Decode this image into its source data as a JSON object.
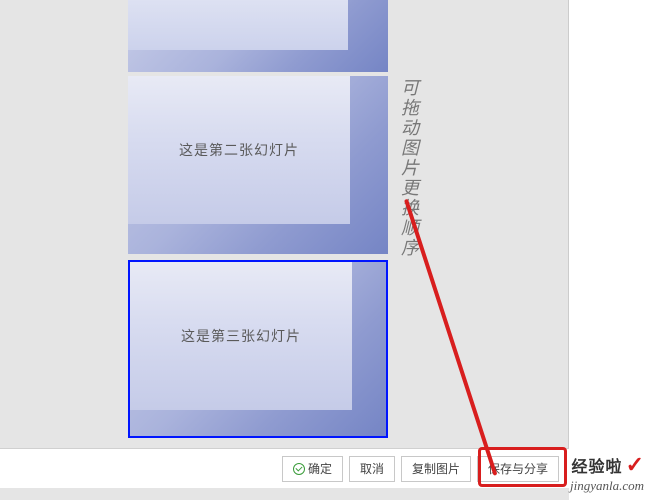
{
  "slides": [
    {
      "text": ""
    },
    {
      "text": "这是第二张幻灯片"
    },
    {
      "text": "这是第三张幻灯片"
    }
  ],
  "hint": "可拖动图片更换顺序",
  "buttons": {
    "ok": "确定",
    "cancel": "取消",
    "copy": "复制图片",
    "save": "保存与分享"
  },
  "watermark": {
    "label": "经验啦",
    "check": "✓",
    "url": "jingyanla.com"
  }
}
